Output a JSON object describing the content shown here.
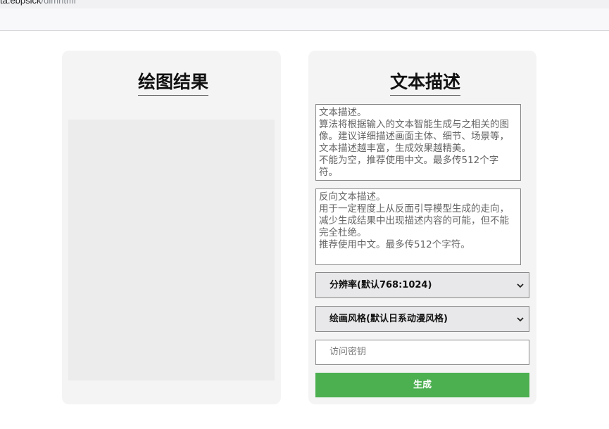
{
  "browser": {
    "url_host": "ta.ebpsick",
    "url_path": "/dimhtml"
  },
  "left_panel": {
    "title": "绘图结果"
  },
  "right_panel": {
    "title": "文本描述",
    "prompt_placeholder": "文本描述。\n算法将根据输入的文本智能生成与之相关的图像。建议详细描述画面主体、细节、场景等，文本描述越丰富，生成效果越精美。\n不能为空，推荐使用中文。最多传512个字符。",
    "negative_placeholder": "反向文本描述。\n用于一定程度上从反面引导模型生成的走向，减少生成结果中出现描述内容的可能，但不能完全杜绝。\n推荐使用中文。最多传512个字符。",
    "resolution_selected": "分辨率(默认768:1024)",
    "style_selected": "绘画风格(默认日系动漫风格)",
    "access_key_placeholder": "访问密钥",
    "generate_label": "生成"
  },
  "colors": {
    "accent_green": "#4caf50",
    "panel_bg": "#f4f4f4"
  },
  "icons": {
    "select_arrow": "chevron-down-icon"
  }
}
